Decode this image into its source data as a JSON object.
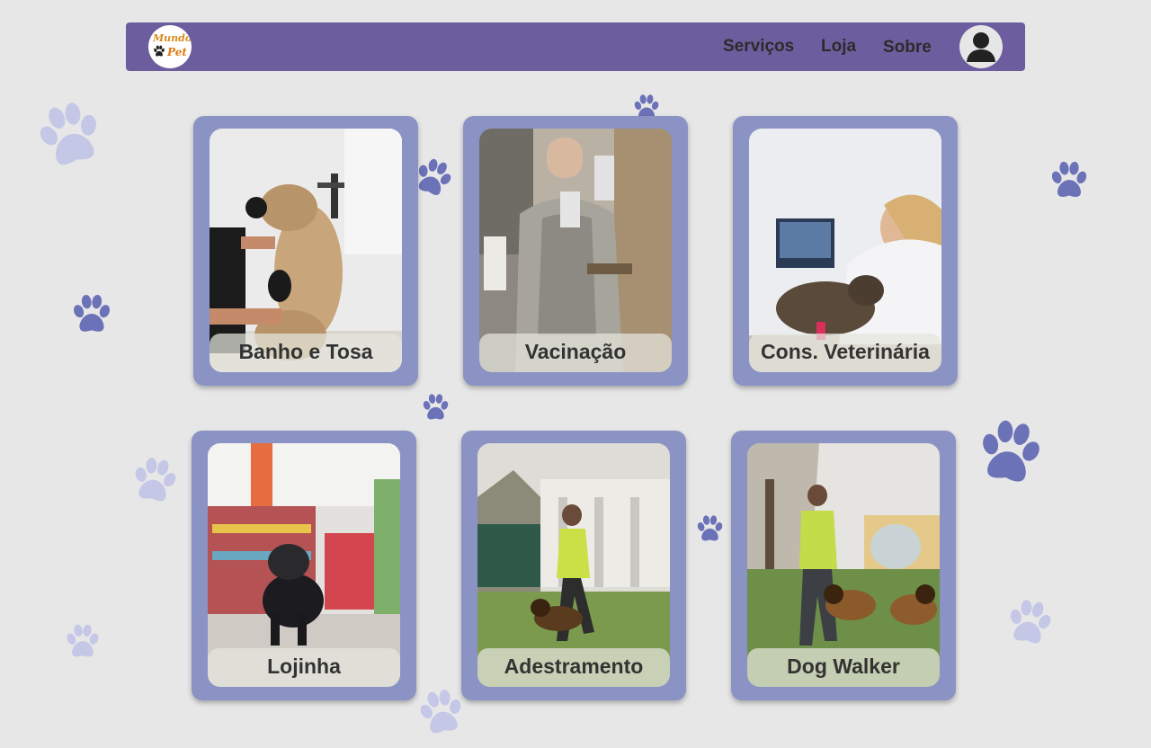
{
  "header": {
    "logo_line1": "Mundo",
    "logo_line2": "Pet",
    "nav": [
      {
        "label": "Serviços"
      },
      {
        "label": "Loja"
      },
      {
        "label": "Sobre"
      }
    ],
    "avatar_icon": "user-icon"
  },
  "services": [
    {
      "label": "Banho e Tosa"
    },
    {
      "label": "Vacinação"
    },
    {
      "label": "Cons. Veterinária"
    },
    {
      "label": "Lojinha"
    },
    {
      "label": "Adestramento"
    },
    {
      "label": "Dog Walker"
    }
  ],
  "colors": {
    "navbar": "#6c5e9e",
    "card": "#8a93c4",
    "paw_dark": "#6b72b8",
    "paw_light": "#c4c7e6",
    "background": "#e7e7e7"
  },
  "decor_icon": "paw-icon"
}
